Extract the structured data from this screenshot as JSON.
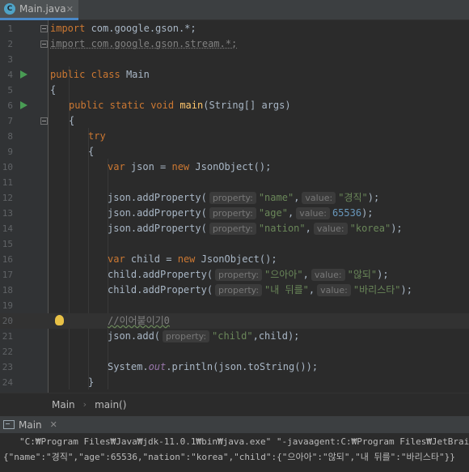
{
  "tab": {
    "icon": "C",
    "label": "Main.java",
    "close": "✕"
  },
  "lines": [
    {
      "n": "1"
    },
    {
      "n": "2"
    },
    {
      "n": "3"
    },
    {
      "n": "4"
    },
    {
      "n": "5"
    },
    {
      "n": "6"
    },
    {
      "n": "7"
    },
    {
      "n": "8"
    },
    {
      "n": "9"
    },
    {
      "n": "10"
    },
    {
      "n": "11"
    },
    {
      "n": "12"
    },
    {
      "n": "13"
    },
    {
      "n": "14"
    },
    {
      "n": "15"
    },
    {
      "n": "16"
    },
    {
      "n": "17"
    },
    {
      "n": "18"
    },
    {
      "n": "19"
    },
    {
      "n": "20"
    },
    {
      "n": "21"
    },
    {
      "n": "22"
    },
    {
      "n": "23"
    },
    {
      "n": "24"
    }
  ],
  "code": {
    "l1": {
      "kw": "import",
      "rest": " com.google.gson.*;"
    },
    "l2": {
      "text": "import com.google.gson.stream.*;"
    },
    "l4": {
      "kw1": "public",
      "kw2": "class",
      "name": " Main"
    },
    "l5": {
      "text": "{"
    },
    "l6": {
      "kw1": "public",
      "kw2": "static",
      "kw3": "void",
      "fn": "main",
      "rest": "(String[] args)"
    },
    "l7": {
      "text": "{"
    },
    "l8": {
      "kw": "try"
    },
    "l9": {
      "text": "{"
    },
    "l10": {
      "kw1": "var",
      "mid": " json = ",
      "kw2": "new",
      "rest": " JsonObject();"
    },
    "l12": {
      "pre": "json.addProperty(",
      "h1": "property:",
      "s1": "\"name\"",
      "c": ",",
      "h2": "value:",
      "s2": "\"경직\"",
      "post": ");"
    },
    "l13": {
      "pre": "json.addProperty(",
      "h1": "property:",
      "s1": "\"age\"",
      "c": ",",
      "h2": "value:",
      "n2": "65536",
      "post": ");"
    },
    "l14": {
      "pre": "json.addProperty(",
      "h1": "property:",
      "s1": "\"nation\"",
      "c": ",",
      "h2": "value:",
      "s2": "\"korea\"",
      "post": ");"
    },
    "l16": {
      "kw1": "var",
      "mid": " child = ",
      "kw2": "new",
      "rest": " JsonObject();"
    },
    "l17": {
      "pre": "child.addProperty(",
      "h1": "property:",
      "s1": "\"으아아\"",
      "c": ",",
      "h2": "value:",
      "s2": "\"않되\"",
      "post": ");"
    },
    "l18": {
      "pre": "child.addProperty(",
      "h1": "property:",
      "s1": "\"내 뒤를\"",
      "c": ",",
      "h2": "value:",
      "s2": "\"바리스타\"",
      "post": ");"
    },
    "l20": {
      "text": "//이어붙이기0"
    },
    "l21": {
      "pre": "json.add(",
      "h1": "property:",
      "s1": "\"child\"",
      "post": ",child);"
    },
    "l23": {
      "pre": "System.",
      "fld": "out",
      "mid": ".println(json.toString());"
    },
    "l24": {
      "text": "}"
    }
  },
  "breadcrumb": {
    "item1": "Main",
    "sep": "›",
    "item2": "main()"
  },
  "run_panel": {
    "label": "Main",
    "close": "✕"
  },
  "console": {
    "line1": "\"C:₩Program Files₩Java₩jdk-11.0.1₩bin₩java.exe\" \"-javaagent:C:₩Program Files₩JetBrains₩IntelliJ",
    "line2": "{\"name\":\"경직\",\"age\":65536,\"nation\":\"korea\",\"child\":{\"으아아\":\"않되\",\"내 뒤를\":\"바리스타\"}}"
  },
  "colors": {
    "accent": "#4a88c7",
    "keyword": "#cc7832",
    "string": "#6a8759",
    "number": "#6897bb",
    "method": "#ffc66d",
    "field": "#9876aa",
    "run": "#499c54"
  }
}
